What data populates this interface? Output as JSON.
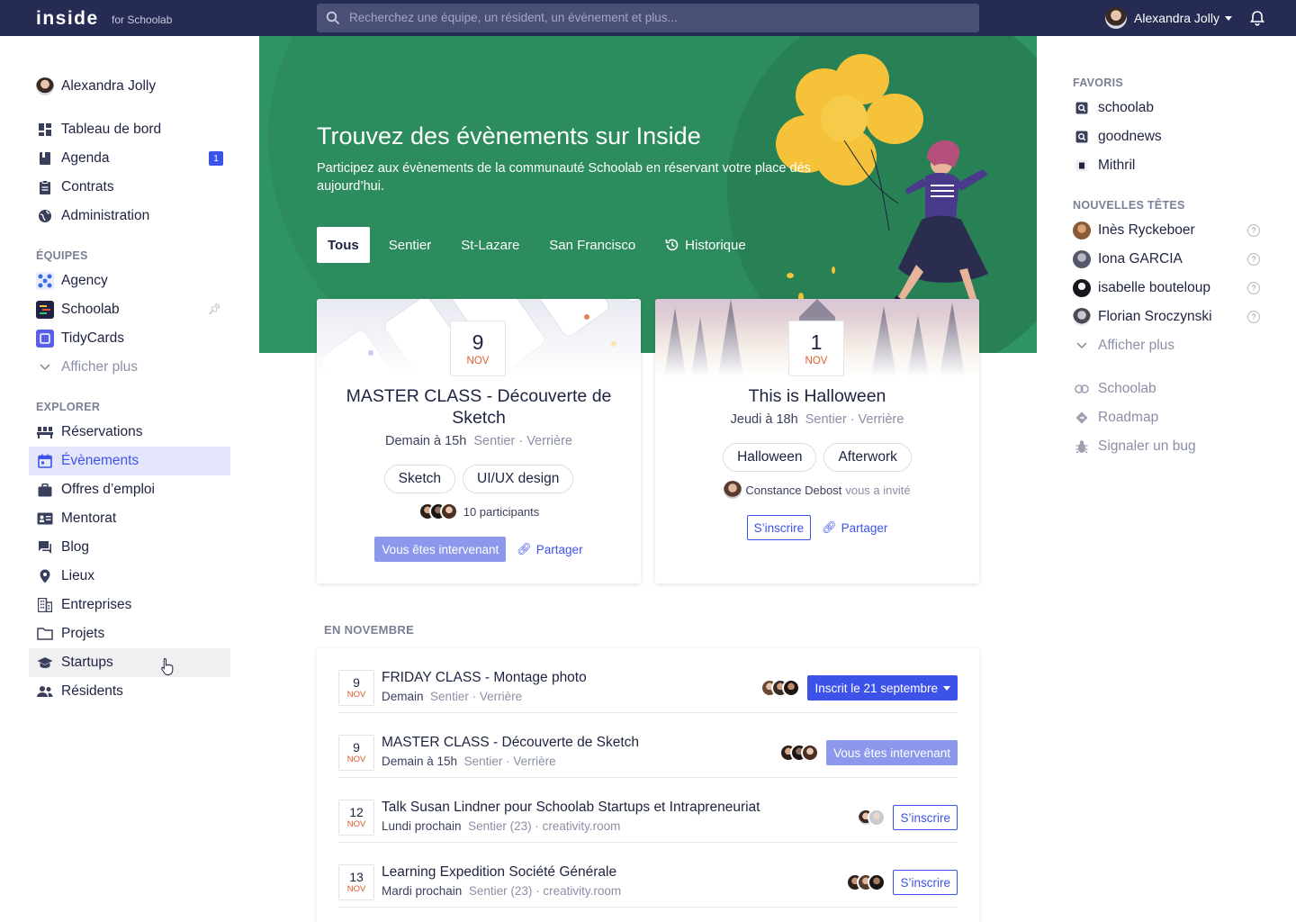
{
  "topbar": {
    "logo": "inside",
    "logo_sub": "for Schoolab",
    "search_placeholder": "Recherchez une équipe, un résident, un évènement et plus...",
    "user_name": "Alexandra Jolly"
  },
  "sidebar": {
    "user_name": "Alexandra Jolly",
    "main_items": [
      {
        "label": "Tableau de bord",
        "icon": "dashboard-icon"
      },
      {
        "label": "Agenda",
        "icon": "book-icon",
        "badge": "1"
      },
      {
        "label": "Contrats",
        "icon": "clipboard-icon"
      },
      {
        "label": "Administration",
        "icon": "globe-icon"
      }
    ],
    "teams_title": "ÉQUIPES",
    "teams": [
      {
        "label": "Agency",
        "color": "#3d6be8"
      },
      {
        "label": "Schoolab",
        "color": "#1d2340"
      },
      {
        "label": "TidyCards",
        "color": "#5a5fe8"
      }
    ],
    "teams_more": "Afficher plus",
    "explore_title": "EXPLORER",
    "explore_items": [
      {
        "label": "Réservations",
        "icon": "seats-icon"
      },
      {
        "label": "Évènements",
        "icon": "calendar-icon"
      },
      {
        "label": "Offres d’emploi",
        "icon": "briefcase-icon"
      },
      {
        "label": "Mentorat",
        "icon": "id-card-icon"
      },
      {
        "label": "Blog",
        "icon": "chat-icon"
      },
      {
        "label": "Lieux",
        "icon": "map-pin-icon"
      },
      {
        "label": "Entreprises",
        "icon": "building-icon"
      },
      {
        "label": "Projets",
        "icon": "folder-icon"
      },
      {
        "label": "Startups",
        "icon": "graduation-cap-icon"
      },
      {
        "label": "Résidents",
        "icon": "people-icon"
      }
    ]
  },
  "hero": {
    "title": "Trouvez des évènements sur Inside",
    "subtitle": "Participez aux évènements de la communauté Schoolab en réservant votre place dés aujourd’hui.",
    "tabs": [
      "Tous",
      "Sentier",
      "St-Lazare",
      "San Francisco",
      "Historique"
    ],
    "bg_color": "#2f9463"
  },
  "cards": [
    {
      "day": "9",
      "month": "NOV",
      "title": "MASTER CLASS - Découverte de Sketch",
      "when": "Demain à 15h",
      "where": "Sentier · Verrière",
      "tags": [
        "Sketch",
        "UI/UX design"
      ],
      "participants": "10 participants",
      "action": "Vous êtes intervenant",
      "share": "Partager"
    },
    {
      "day": "1",
      "month": "NOV",
      "title": "This is Halloween",
      "when": "Jeudi à 18h",
      "where": "Sentier · Verrière",
      "tags": [
        "Halloween",
        "Afterwork"
      ],
      "inviter": "Constance Debost",
      "invite_text": "vous a invité",
      "action": "S’inscrire",
      "share": "Partager"
    }
  ],
  "november": {
    "title": "EN NOVEMBRE",
    "rows": [
      {
        "day": "9",
        "month": "NOV",
        "title": "FRIDAY CLASS - Montage photo",
        "when": "Demain",
        "where": "Sentier · Verrière",
        "action": "Inscrit le 21 septembre"
      },
      {
        "day": "9",
        "month": "NOV",
        "title": "MASTER CLASS - Découverte de Sketch",
        "when": "Demain à 15h",
        "where": "Sentier · Verrière",
        "action": "Vous êtes intervenant"
      },
      {
        "day": "12",
        "month": "NOV",
        "title": "Talk Susan Lindner pour Schoolab Startups et Intrapreneuriat",
        "when": "Lundi prochain",
        "where": "Sentier (23) · creativity.room",
        "action": "S’inscrire"
      },
      {
        "day": "13",
        "month": "NOV",
        "title": "Learning Expedition Société Générale",
        "when": "Mardi prochain",
        "where": "Sentier (23) · creativity.room",
        "action": "S’inscrire"
      }
    ]
  },
  "right": {
    "favorites_title": "FAVORIS",
    "favorites": [
      "schoolab",
      "goodnews",
      "Mithril"
    ],
    "newcomers_title": "NOUVELLES TÊTES",
    "newcomers": [
      "Inès Ryckeboer",
      "Iona GARCIA",
      "isabelle bouteloup",
      "Florian Sroczynski"
    ],
    "more": "Afficher plus",
    "links": [
      "Schoolab",
      "Roadmap",
      "Signaler un bug"
    ]
  }
}
